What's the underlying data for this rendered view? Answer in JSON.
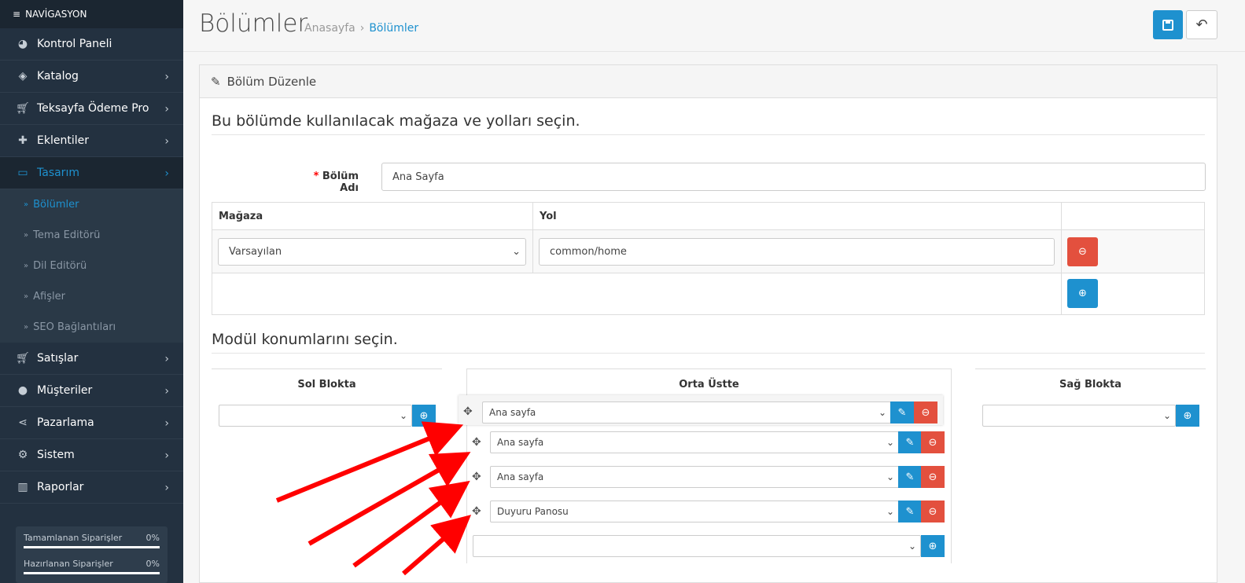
{
  "sidebar": {
    "header": "NAVİGASYON",
    "items": [
      {
        "label": "Kontrol Paneli",
        "icon": "dashboard-icon"
      },
      {
        "label": "Katalog",
        "icon": "tags-icon"
      },
      {
        "label": "Teksayfa Ödeme Pro",
        "icon": "cart-icon"
      },
      {
        "label": "Eklentiler",
        "icon": "puzzle-icon"
      },
      {
        "label": "Tasarım",
        "icon": "monitor-icon",
        "active": true
      },
      {
        "label": "Satışlar",
        "icon": "cart-icon"
      },
      {
        "label": "Müşteriler",
        "icon": "user-icon"
      },
      {
        "label": "Pazarlama",
        "icon": "share-icon"
      },
      {
        "label": "Sistem",
        "icon": "cog-icon"
      },
      {
        "label": "Raporlar",
        "icon": "bar-chart-icon"
      }
    ],
    "subitems": [
      "Bölümler",
      "Tema Editörü",
      "Dil Editörü",
      "Afişler",
      "SEO Bağlantıları"
    ],
    "stats": [
      {
        "label": "Tamamlanan Siparişler",
        "value": "0%"
      },
      {
        "label": "Hazırlanan Siparişler",
        "value": "0%"
      }
    ]
  },
  "header": {
    "title": "Bölümler",
    "breadcrumb": [
      "Anasayfa",
      "Bölümler"
    ]
  },
  "panel": {
    "heading": "Bölüm Düzenle",
    "legend1": "Bu bölümde kullanılacak mağaza ve yolları seçin.",
    "name_label": "Bölüm Adı",
    "name_value": "Ana Sayfa",
    "table_headers": [
      "Mağaza",
      "Yol"
    ],
    "store_value": "Varsayılan",
    "route_value": "common/home",
    "legend2": "Modül konumlarını seçin.",
    "columns": [
      "Sol Blokta",
      "Orta Üstte",
      "Sağ Blokta"
    ],
    "content_top_modules": [
      "Ana sayfa",
      "Ana sayfa",
      "Ana sayfa",
      "Duyuru Panosu"
    ]
  },
  "colors": {
    "accent": "#1e91cf",
    "danger": "#e3503e",
    "sidebar": "#233140",
    "annotation": "#ff0000"
  }
}
